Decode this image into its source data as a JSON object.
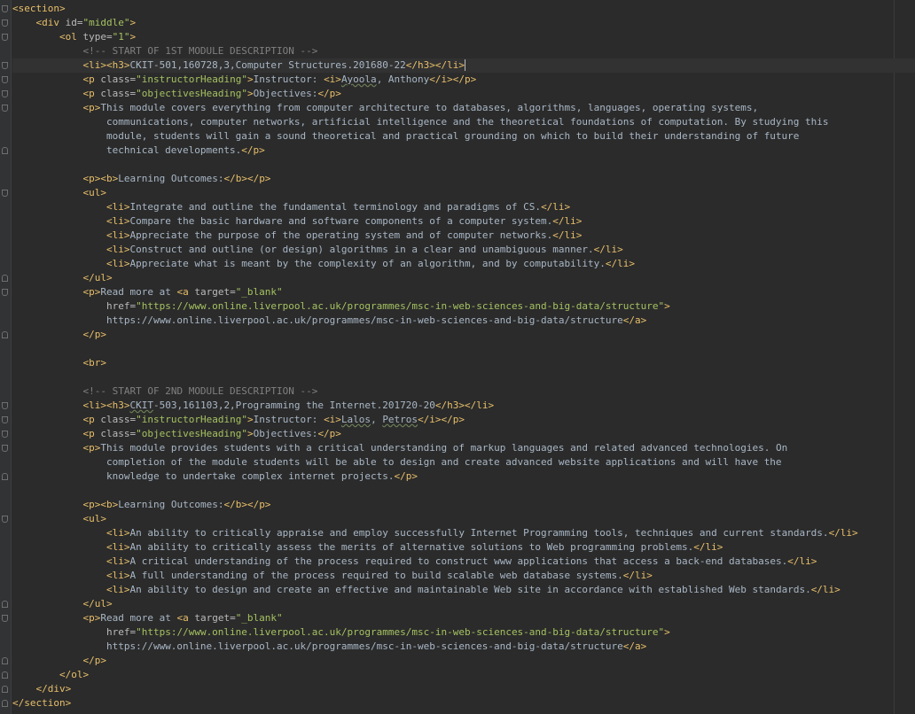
{
  "editor": {
    "lines": [
      {
        "segs": [
          [
            "tg",
            "<section>"
          ]
        ]
      },
      {
        "segs": [
          [
            "tx",
            "    "
          ],
          [
            "tg",
            "<div "
          ],
          [
            "at",
            "id="
          ],
          [
            "vl",
            "\"middle\""
          ],
          [
            "tg",
            ">"
          ]
        ]
      },
      {
        "segs": [
          [
            "tx",
            "        "
          ],
          [
            "tg",
            "<ol "
          ],
          [
            "at",
            "type="
          ],
          [
            "vl",
            "\"1\""
          ],
          [
            "tg",
            ">"
          ]
        ]
      },
      {
        "segs": [
          [
            "tx",
            "            "
          ],
          [
            "cm",
            "<!-- START OF 1ST MODULE DESCRIPTION -->"
          ]
        ]
      },
      {
        "cur": true,
        "segs": [
          [
            "tx",
            "            "
          ],
          [
            "tg",
            "<li><h3>"
          ],
          [
            "tx",
            "CKIT-501,160728,3,Computer Structures.201680-22"
          ],
          [
            "tg",
            "</h3></li>"
          ]
        ]
      },
      {
        "segs": [
          [
            "tx",
            "            "
          ],
          [
            "tg",
            "<p "
          ],
          [
            "at",
            "class="
          ],
          [
            "vl",
            "\"instructorHeading\""
          ],
          [
            "tg",
            ">"
          ],
          [
            "tx",
            "Instructor: "
          ],
          [
            "tg",
            "<i>"
          ],
          [
            "sq",
            "Ayoola"
          ],
          [
            "tx",
            ", Anthony"
          ],
          [
            "tg",
            "</i></p>"
          ]
        ]
      },
      {
        "segs": [
          [
            "tx",
            "            "
          ],
          [
            "tg",
            "<p "
          ],
          [
            "at",
            "class="
          ],
          [
            "vl",
            "\"objectivesHeading\""
          ],
          [
            "tg",
            ">"
          ],
          [
            "tx",
            "Objectives:"
          ],
          [
            "tg",
            "</p>"
          ]
        ]
      },
      {
        "segs": [
          [
            "tx",
            "            "
          ],
          [
            "tg",
            "<p>"
          ],
          [
            "tx",
            "This module covers everything from computer architecture to databases, algorithms, languages, operating systems,"
          ]
        ]
      },
      {
        "segs": [
          [
            "tx",
            "                communications, computer networks, artificial intelligence and the theoretical foundations of computation. By studying this"
          ]
        ]
      },
      {
        "segs": [
          [
            "tx",
            "                module, students will gain a sound theoretical and practical grounding on which to build their understanding of future"
          ]
        ]
      },
      {
        "segs": [
          [
            "tx",
            "                technical developments."
          ],
          [
            "tg",
            "</p>"
          ]
        ]
      },
      {
        "segs": []
      },
      {
        "segs": [
          [
            "tx",
            "            "
          ],
          [
            "tg",
            "<p><b>"
          ],
          [
            "tx",
            "Learning Outcomes:"
          ],
          [
            "tg",
            "</b></p>"
          ]
        ]
      },
      {
        "segs": [
          [
            "tx",
            "            "
          ],
          [
            "tg",
            "<ul>"
          ]
        ]
      },
      {
        "segs": [
          [
            "tx",
            "                "
          ],
          [
            "tg",
            "<li>"
          ],
          [
            "tx",
            "Integrate and outline the fundamental terminology and paradigms of CS."
          ],
          [
            "tg",
            "</li>"
          ]
        ]
      },
      {
        "segs": [
          [
            "tx",
            "                "
          ],
          [
            "tg",
            "<li>"
          ],
          [
            "tx",
            "Compare the basic hardware and software components of a computer system."
          ],
          [
            "tg",
            "</li>"
          ]
        ]
      },
      {
        "segs": [
          [
            "tx",
            "                "
          ],
          [
            "tg",
            "<li>"
          ],
          [
            "tx",
            "Appreciate the purpose of the operating system and of computer networks."
          ],
          [
            "tg",
            "</li>"
          ]
        ]
      },
      {
        "segs": [
          [
            "tx",
            "                "
          ],
          [
            "tg",
            "<li>"
          ],
          [
            "tx",
            "Construct and outline (or design) algorithms in a clear and unambiguous manner."
          ],
          [
            "tg",
            "</li>"
          ]
        ]
      },
      {
        "segs": [
          [
            "tx",
            "                "
          ],
          [
            "tg",
            "<li>"
          ],
          [
            "tx",
            "Appreciate what is meant by the complexity of an algorithm, and by computability."
          ],
          [
            "tg",
            "</li>"
          ]
        ]
      },
      {
        "segs": [
          [
            "tx",
            "            "
          ],
          [
            "tg",
            "</ul>"
          ]
        ]
      },
      {
        "segs": [
          [
            "tx",
            "            "
          ],
          [
            "tg",
            "<p>"
          ],
          [
            "tx",
            "Read more at "
          ],
          [
            "tg",
            "<a "
          ],
          [
            "at",
            "target="
          ],
          [
            "vl",
            "\"_blank\""
          ]
        ]
      },
      {
        "segs": [
          [
            "tx",
            "                "
          ],
          [
            "at",
            "href="
          ],
          [
            "vl",
            "\"https://www.online.liverpool.ac.uk/programmes/msc-in-web-sciences-and-big-data/structure\""
          ],
          [
            "tg",
            ">"
          ]
        ]
      },
      {
        "segs": [
          [
            "tx",
            "                https://www.online.liverpool.ac.uk/programmes/msc-in-web-sciences-and-big-data/structure"
          ],
          [
            "tg",
            "</a>"
          ]
        ]
      },
      {
        "segs": [
          [
            "tx",
            "            "
          ],
          [
            "tg",
            "</p>"
          ]
        ]
      },
      {
        "segs": []
      },
      {
        "segs": [
          [
            "tx",
            "            "
          ],
          [
            "tg",
            "<br>"
          ]
        ]
      },
      {
        "segs": []
      },
      {
        "segs": [
          [
            "tx",
            "            "
          ],
          [
            "cm",
            "<!-- START OF 2ND MODULE DESCRIPTION -->"
          ]
        ]
      },
      {
        "segs": [
          [
            "tx",
            "            "
          ],
          [
            "tg",
            "<li><h3>"
          ],
          [
            "sq",
            "CKIT"
          ],
          [
            "tx",
            "-503,161103,2,Programming the Internet.201720-20"
          ],
          [
            "tg",
            "</h3></li>"
          ]
        ]
      },
      {
        "segs": [
          [
            "tx",
            "            "
          ],
          [
            "tg",
            "<p "
          ],
          [
            "at",
            "class="
          ],
          [
            "vl",
            "\"instructorHeading\""
          ],
          [
            "tg",
            ">"
          ],
          [
            "tx",
            "Instructor: "
          ],
          [
            "tg",
            "<i>"
          ],
          [
            "sq",
            "Lalos"
          ],
          [
            "tx",
            ", "
          ],
          [
            "sq",
            "Petros"
          ],
          [
            "tg",
            "</i></p>"
          ]
        ]
      },
      {
        "segs": [
          [
            "tx",
            "            "
          ],
          [
            "tg",
            "<p "
          ],
          [
            "at",
            "class="
          ],
          [
            "vl",
            "\"objectivesHeading\""
          ],
          [
            "tg",
            ">"
          ],
          [
            "tx",
            "Objectives:"
          ],
          [
            "tg",
            "</p>"
          ]
        ]
      },
      {
        "segs": [
          [
            "tx",
            "            "
          ],
          [
            "tg",
            "<p>"
          ],
          [
            "tx",
            "This module provides students with a critical understanding of markup languages and related advanced technologies. On"
          ]
        ]
      },
      {
        "segs": [
          [
            "tx",
            "                completion of the module students will be able to design and create advanced website applications and will have the"
          ]
        ]
      },
      {
        "segs": [
          [
            "tx",
            "                knowledge to undertake complex internet projects."
          ],
          [
            "tg",
            "</p>"
          ]
        ]
      },
      {
        "segs": []
      },
      {
        "segs": [
          [
            "tx",
            "            "
          ],
          [
            "tg",
            "<p><b>"
          ],
          [
            "tx",
            "Learning Outcomes:"
          ],
          [
            "tg",
            "</b></p>"
          ]
        ]
      },
      {
        "segs": [
          [
            "tx",
            "            "
          ],
          [
            "tg",
            "<ul>"
          ]
        ]
      },
      {
        "segs": [
          [
            "tx",
            "                "
          ],
          [
            "tg",
            "<li>"
          ],
          [
            "tx",
            "An ability to critically appraise and employ successfully Internet Programming tools, techniques and current standards."
          ],
          [
            "tg",
            "</li>"
          ]
        ]
      },
      {
        "segs": [
          [
            "tx",
            "                "
          ],
          [
            "tg",
            "<li>"
          ],
          [
            "tx",
            "An ability to critically assess the merits of alternative solutions to Web programming problems."
          ],
          [
            "tg",
            "</li>"
          ]
        ]
      },
      {
        "segs": [
          [
            "tx",
            "                "
          ],
          [
            "tg",
            "<li>"
          ],
          [
            "tx",
            "A critical understanding of the process required to construct www applications that access a back-end databases."
          ],
          [
            "tg",
            "</li>"
          ]
        ]
      },
      {
        "segs": [
          [
            "tx",
            "                "
          ],
          [
            "tg",
            "<li>"
          ],
          [
            "tx",
            "A full understanding of the process required to build scalable web database systems."
          ],
          [
            "tg",
            "</li>"
          ]
        ]
      },
      {
        "segs": [
          [
            "tx",
            "                "
          ],
          [
            "tg",
            "<li>"
          ],
          [
            "tx",
            "An ability to design and create an effective and maintainable Web site in accordance with established Web standards."
          ],
          [
            "tg",
            "</li>"
          ]
        ]
      },
      {
        "segs": [
          [
            "tx",
            "            "
          ],
          [
            "tg",
            "</ul>"
          ]
        ]
      },
      {
        "segs": [
          [
            "tx",
            "            "
          ],
          [
            "tg",
            "<p>"
          ],
          [
            "tx",
            "Read more at "
          ],
          [
            "tg",
            "<a "
          ],
          [
            "at",
            "target="
          ],
          [
            "vl",
            "\"_blank\""
          ]
        ]
      },
      {
        "segs": [
          [
            "tx",
            "                "
          ],
          [
            "at",
            "href="
          ],
          [
            "vl",
            "\"https://www.online.liverpool.ac.uk/programmes/msc-in-web-sciences-and-big-data/structure\""
          ],
          [
            "tg",
            ">"
          ]
        ]
      },
      {
        "segs": [
          [
            "tx",
            "                https://www.online.liverpool.ac.uk/programmes/msc-in-web-sciences-and-big-data/structure"
          ],
          [
            "tg",
            "</a>"
          ]
        ]
      },
      {
        "segs": [
          [
            "tx",
            "            "
          ],
          [
            "tg",
            "</p>"
          ]
        ]
      },
      {
        "segs": [
          [
            "tx",
            "        "
          ],
          [
            "tg",
            "</ol>"
          ]
        ]
      },
      {
        "segs": [
          [
            "tx",
            "    "
          ],
          [
            "tg",
            "</div>"
          ]
        ]
      },
      {
        "segs": [
          [
            "tg",
            "</section>"
          ]
        ]
      }
    ]
  },
  "gutter": {
    "fold_open_lines": [
      0,
      1,
      2,
      4,
      5,
      6,
      7,
      13,
      20,
      28,
      29,
      30,
      31,
      36,
      43
    ],
    "fold_close_lines": [
      10,
      19,
      23,
      33,
      42,
      46,
      47,
      48,
      49
    ]
  },
  "colors": {
    "background": "#2b2b2b",
    "gutter": "#313335",
    "tag": "#e8bf6a",
    "attribute": "#bababa",
    "attribute_value": "#a5c261",
    "comment": "#808080",
    "text": "#a9b7c6"
  }
}
